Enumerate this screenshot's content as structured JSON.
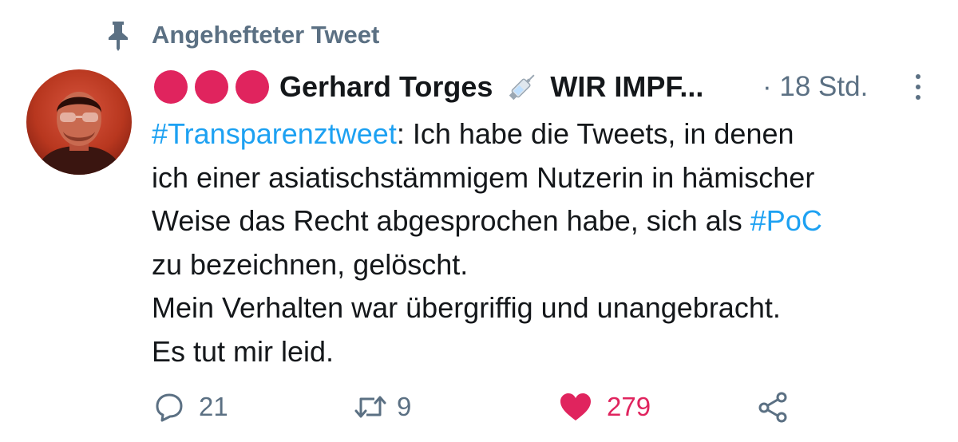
{
  "pinned": {
    "label": "Angehefteter Tweet",
    "icon": "pin-icon"
  },
  "author": {
    "display_name": "Gerhard Torges",
    "emoji_icon": "syringe-icon",
    "name_suffix": "WIR IMPF...",
    "avatar": "avatar-photo",
    "dots_color": "#e0245e"
  },
  "meta": {
    "time": "· 18 Std.",
    "more_icon": "more-vertical-icon"
  },
  "tweet": {
    "line1_hashtag": "#Transparenztweet",
    "line1_text": ": Ich habe die Tweets, in denen",
    "line2": "ich einer asiatischstämmigem Nutzerin in hämischer",
    "line3_text": "Weise das Recht abgesprochen habe, sich als ",
    "line3_hashtag": "#PoC",
    "line4": "zu bezeichnen, gelöscht.",
    "line5": "Mein Verhalten war übergriffig und unangebracht.",
    "line6": "Es tut mir leid."
  },
  "actions": {
    "reply_count": "21",
    "retweet_count": "9",
    "like_count": "279",
    "like_color": "#e0245e",
    "reply_icon": "reply-icon",
    "retweet_icon": "retweet-icon",
    "like_icon": "heart-icon",
    "share_icon": "share-icon"
  },
  "colors": {
    "hashtag": "#1da1f2",
    "secondary_text": "#5b7083",
    "primary_text": "#14171a"
  }
}
